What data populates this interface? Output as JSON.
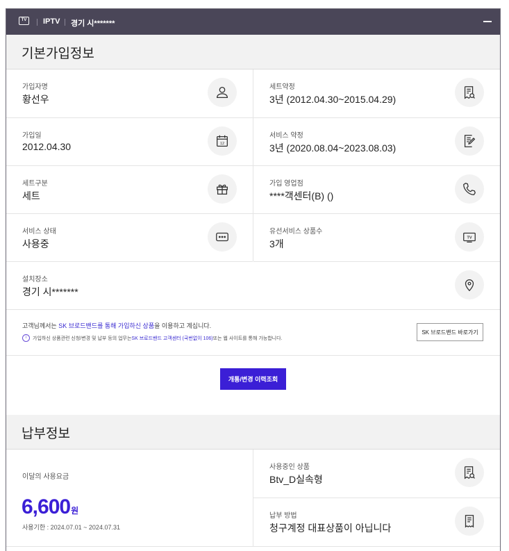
{
  "header": {
    "tv_icon_text": "TV",
    "service": "IPTV",
    "address": "경기 시*******"
  },
  "basic": {
    "title": "기본가입정보",
    "fields": [
      {
        "label": "가입자명",
        "value": "황선우",
        "icon": "person-icon"
      },
      {
        "label": "세트약정",
        "value": "3년 (2012.04.30~2015.04.29)",
        "icon": "receipt-search-icon"
      },
      {
        "label": "가입일",
        "value": "2012.04.30",
        "icon": "calendar-icon"
      },
      {
        "label": "서비스 약정",
        "value": "3년 (2020.08.04~2023.08.03)",
        "icon": "document-edit-icon"
      },
      {
        "label": "세트구분",
        "value": "세트",
        "icon": "gift-icon"
      },
      {
        "label": "가입 영업점",
        "value": "****객센터(B) ()",
        "icon": "phone-icon"
      },
      {
        "label": "서비스 상태",
        "value": "사용중",
        "icon": "message-icon"
      },
      {
        "label": "유선서비스 상품수",
        "value": "3개",
        "icon": "tv-icon"
      },
      {
        "label": "설치장소",
        "value": "경기 시*******",
        "icon": "location-pin-icon"
      }
    ],
    "notice": {
      "line1_a": "고객님께서는 ",
      "line1_b": "SK 브로드밴드를 통해 가입하신 상품",
      "line1_c": "을 이용하고 계십니다.",
      "line2_a": "가입하신 상품관련 신청/변경 및 납부 등의 업무는 ",
      "line2_b": "SK 브로드밴드 고객센터 (국번없이 106)",
      "line2_c": " 또는 웹 사이트를 통해 가능합니다.",
      "info_icon_text": "i",
      "link_button": "SK 브로드밴드 바로가기"
    },
    "history_button": "개통/변경 이력조회"
  },
  "payment": {
    "title": "납부정보",
    "monthly_label": "이달의 사용요금",
    "amount": "6,600",
    "unit": "원",
    "period": "사용기한 : 2024.07.01 ~ 2024.07.31",
    "fields": [
      {
        "label": "사용중인 상품",
        "value": "Btv_D실속형",
        "icon": "receipt-search-icon"
      },
      {
        "label": "납부 방법",
        "value": "청구계정 대표상품이 아닙니다",
        "icon": "bill-icon"
      }
    ]
  },
  "colors": {
    "header_bg": "#4a4658",
    "accent": "#3b1fd6",
    "section_bg": "#f2f2f2"
  }
}
